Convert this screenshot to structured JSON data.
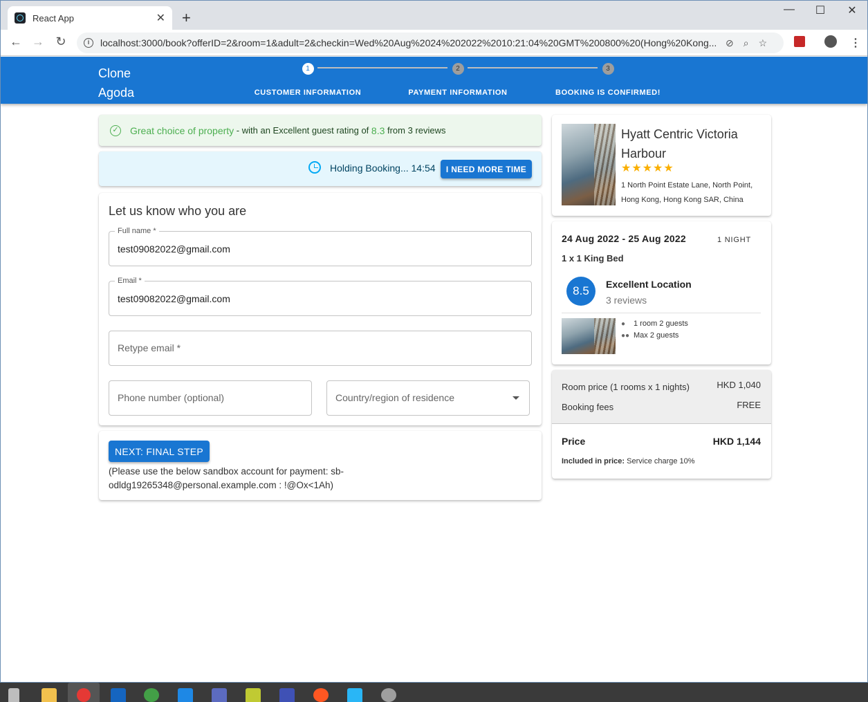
{
  "browser": {
    "tab_title": "React App",
    "tab_close": "✕",
    "new_tab": "+",
    "url": "localhost:3000/book?offerID=2&room=1&adult=2&checkin=Wed%20Aug%2024%202022%2010:21:04%20GMT%200800%20(Hong%20Kong...",
    "window_controls": {
      "minimize": "—",
      "maximize": "☐",
      "close": "✕"
    }
  },
  "appbar": {
    "brand": "Clone Agoda",
    "steps": [
      {
        "number": "1",
        "label": "CUSTOMER INFORMATION",
        "active": true
      },
      {
        "number": "2",
        "label": "PAYMENT INFORMATION",
        "active": false
      },
      {
        "number": "3",
        "label": "BOOKING IS CONFIRMED!",
        "active": false
      }
    ]
  },
  "rating_alert": {
    "highlight": "Great choice of property",
    "middle": " - with an Excellent guest rating of ",
    "score": "8.3",
    "suffix": " from 3 reviews"
  },
  "hold_alert": {
    "text": "Holding Booking... 14:54",
    "button": "I NEED MORE TIME"
  },
  "form": {
    "title": "Let us know who you are",
    "full_name": {
      "label": "Full name *",
      "value": "test09082022@gmail.com"
    },
    "email": {
      "label": "Email *",
      "value": "test09082022@gmail.com"
    },
    "retype_email": {
      "placeholder": "Retype email *"
    },
    "phone": {
      "placeholder": "Phone number (optional)"
    },
    "country": {
      "placeholder": "Country/region of residence"
    }
  },
  "next": {
    "button": "NEXT: FINAL STEP",
    "note": "(Please use the below sandbox account for payment: sb-odldg19265348@personal.example.com : !@Ox<1Ah)"
  },
  "hotel": {
    "name": "Hyatt Centric Victoria Harbour",
    "stars": "★★★★★",
    "star_rating": 5,
    "address": "1 North Point Estate Lane, North Point, Hong Kong, Hong Kong SAR, China"
  },
  "stay": {
    "dates": "24 Aug 2022 - 25 Aug 2022",
    "nights": "1 NIGHT",
    "bed": "1 x 1 King Bed",
    "score": "8.5",
    "location_title": "Excellent Location",
    "location_reviews": "3 reviews",
    "room_guests": "1 room 2 guests",
    "max_guests": "Max 2 guests"
  },
  "price": {
    "room_label": "Room price (1 rooms x 1 nights)",
    "room_value": "HKD 1,040",
    "fees_label": "Booking fees",
    "fees_value": "FREE",
    "total_label": "Price",
    "total_value": "HKD 1,144",
    "included_label": "Included in price:",
    "included_value": " Service charge 10%"
  },
  "colors": {
    "primary": "#1976d2",
    "success": "#4caf50",
    "info_bg": "#e5f6fd",
    "success_bg": "#edf7ed",
    "star": "#faaf00"
  }
}
